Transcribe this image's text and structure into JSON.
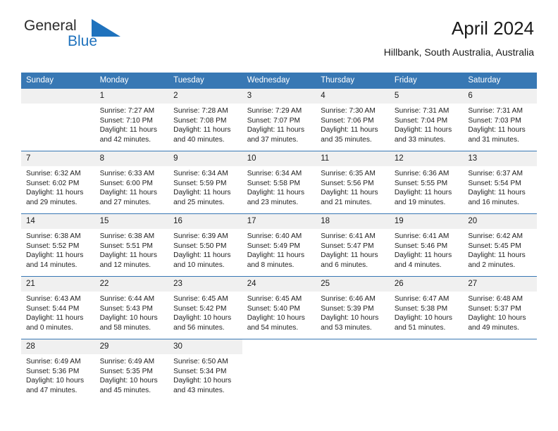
{
  "brand": {
    "name_top": "General",
    "name_bottom": "Blue",
    "triangle_color": "#1f72bd",
    "accent_color": "#1f72bd"
  },
  "header": {
    "title": "April 2024",
    "subtitle": "Hillbank, South Australia, Australia",
    "header_bg": "#3878b4",
    "header_text": "#ffffff",
    "daynum_bg": "#f0f0f0"
  },
  "weekdays": [
    "Sunday",
    "Monday",
    "Tuesday",
    "Wednesday",
    "Thursday",
    "Friday",
    "Saturday"
  ],
  "labels": {
    "sunrise": "Sunrise:",
    "sunset": "Sunset:",
    "daylight": "Daylight:"
  },
  "weeks": [
    [
      {
        "day": "",
        "sunrise": "",
        "sunset": "",
        "daylight1": "",
        "daylight2": "",
        "empty": true
      },
      {
        "day": "1",
        "sunrise": "Sunrise: 7:27 AM",
        "sunset": "Sunset: 7:10 PM",
        "daylight1": "Daylight: 11 hours",
        "daylight2": "and 42 minutes."
      },
      {
        "day": "2",
        "sunrise": "Sunrise: 7:28 AM",
        "sunset": "Sunset: 7:08 PM",
        "daylight1": "Daylight: 11 hours",
        "daylight2": "and 40 minutes."
      },
      {
        "day": "3",
        "sunrise": "Sunrise: 7:29 AM",
        "sunset": "Sunset: 7:07 PM",
        "daylight1": "Daylight: 11 hours",
        "daylight2": "and 37 minutes."
      },
      {
        "day": "4",
        "sunrise": "Sunrise: 7:30 AM",
        "sunset": "Sunset: 7:06 PM",
        "daylight1": "Daylight: 11 hours",
        "daylight2": "and 35 minutes."
      },
      {
        "day": "5",
        "sunrise": "Sunrise: 7:31 AM",
        "sunset": "Sunset: 7:04 PM",
        "daylight1": "Daylight: 11 hours",
        "daylight2": "and 33 minutes."
      },
      {
        "day": "6",
        "sunrise": "Sunrise: 7:31 AM",
        "sunset": "Sunset: 7:03 PM",
        "daylight1": "Daylight: 11 hours",
        "daylight2": "and 31 minutes."
      }
    ],
    [
      {
        "day": "7",
        "sunrise": "Sunrise: 6:32 AM",
        "sunset": "Sunset: 6:02 PM",
        "daylight1": "Daylight: 11 hours",
        "daylight2": "and 29 minutes."
      },
      {
        "day": "8",
        "sunrise": "Sunrise: 6:33 AM",
        "sunset": "Sunset: 6:00 PM",
        "daylight1": "Daylight: 11 hours",
        "daylight2": "and 27 minutes."
      },
      {
        "day": "9",
        "sunrise": "Sunrise: 6:34 AM",
        "sunset": "Sunset: 5:59 PM",
        "daylight1": "Daylight: 11 hours",
        "daylight2": "and 25 minutes."
      },
      {
        "day": "10",
        "sunrise": "Sunrise: 6:34 AM",
        "sunset": "Sunset: 5:58 PM",
        "daylight1": "Daylight: 11 hours",
        "daylight2": "and 23 minutes."
      },
      {
        "day": "11",
        "sunrise": "Sunrise: 6:35 AM",
        "sunset": "Sunset: 5:56 PM",
        "daylight1": "Daylight: 11 hours",
        "daylight2": "and 21 minutes."
      },
      {
        "day": "12",
        "sunrise": "Sunrise: 6:36 AM",
        "sunset": "Sunset: 5:55 PM",
        "daylight1": "Daylight: 11 hours",
        "daylight2": "and 19 minutes."
      },
      {
        "day": "13",
        "sunrise": "Sunrise: 6:37 AM",
        "sunset": "Sunset: 5:54 PM",
        "daylight1": "Daylight: 11 hours",
        "daylight2": "and 16 minutes."
      }
    ],
    [
      {
        "day": "14",
        "sunrise": "Sunrise: 6:38 AM",
        "sunset": "Sunset: 5:52 PM",
        "daylight1": "Daylight: 11 hours",
        "daylight2": "and 14 minutes."
      },
      {
        "day": "15",
        "sunrise": "Sunrise: 6:38 AM",
        "sunset": "Sunset: 5:51 PM",
        "daylight1": "Daylight: 11 hours",
        "daylight2": "and 12 minutes."
      },
      {
        "day": "16",
        "sunrise": "Sunrise: 6:39 AM",
        "sunset": "Sunset: 5:50 PM",
        "daylight1": "Daylight: 11 hours",
        "daylight2": "and 10 minutes."
      },
      {
        "day": "17",
        "sunrise": "Sunrise: 6:40 AM",
        "sunset": "Sunset: 5:49 PM",
        "daylight1": "Daylight: 11 hours",
        "daylight2": "and 8 minutes."
      },
      {
        "day": "18",
        "sunrise": "Sunrise: 6:41 AM",
        "sunset": "Sunset: 5:47 PM",
        "daylight1": "Daylight: 11 hours",
        "daylight2": "and 6 minutes."
      },
      {
        "day": "19",
        "sunrise": "Sunrise: 6:41 AM",
        "sunset": "Sunset: 5:46 PM",
        "daylight1": "Daylight: 11 hours",
        "daylight2": "and 4 minutes."
      },
      {
        "day": "20",
        "sunrise": "Sunrise: 6:42 AM",
        "sunset": "Sunset: 5:45 PM",
        "daylight1": "Daylight: 11 hours",
        "daylight2": "and 2 minutes."
      }
    ],
    [
      {
        "day": "21",
        "sunrise": "Sunrise: 6:43 AM",
        "sunset": "Sunset: 5:44 PM",
        "daylight1": "Daylight: 11 hours",
        "daylight2": "and 0 minutes."
      },
      {
        "day": "22",
        "sunrise": "Sunrise: 6:44 AM",
        "sunset": "Sunset: 5:43 PM",
        "daylight1": "Daylight: 10 hours",
        "daylight2": "and 58 minutes."
      },
      {
        "day": "23",
        "sunrise": "Sunrise: 6:45 AM",
        "sunset": "Sunset: 5:42 PM",
        "daylight1": "Daylight: 10 hours",
        "daylight2": "and 56 minutes."
      },
      {
        "day": "24",
        "sunrise": "Sunrise: 6:45 AM",
        "sunset": "Sunset: 5:40 PM",
        "daylight1": "Daylight: 10 hours",
        "daylight2": "and 54 minutes."
      },
      {
        "day": "25",
        "sunrise": "Sunrise: 6:46 AM",
        "sunset": "Sunset: 5:39 PM",
        "daylight1": "Daylight: 10 hours",
        "daylight2": "and 53 minutes."
      },
      {
        "day": "26",
        "sunrise": "Sunrise: 6:47 AM",
        "sunset": "Sunset: 5:38 PM",
        "daylight1": "Daylight: 10 hours",
        "daylight2": "and 51 minutes."
      },
      {
        "day": "27",
        "sunrise": "Sunrise: 6:48 AM",
        "sunset": "Sunset: 5:37 PM",
        "daylight1": "Daylight: 10 hours",
        "daylight2": "and 49 minutes."
      }
    ],
    [
      {
        "day": "28",
        "sunrise": "Sunrise: 6:49 AM",
        "sunset": "Sunset: 5:36 PM",
        "daylight1": "Daylight: 10 hours",
        "daylight2": "and 47 minutes."
      },
      {
        "day": "29",
        "sunrise": "Sunrise: 6:49 AM",
        "sunset": "Sunset: 5:35 PM",
        "daylight1": "Daylight: 10 hours",
        "daylight2": "and 45 minutes."
      },
      {
        "day": "30",
        "sunrise": "Sunrise: 6:50 AM",
        "sunset": "Sunset: 5:34 PM",
        "daylight1": "Daylight: 10 hours",
        "daylight2": "and 43 minutes."
      },
      {
        "day": "",
        "sunrise": "",
        "sunset": "",
        "daylight1": "",
        "daylight2": "",
        "blank": true
      },
      {
        "day": "",
        "sunrise": "",
        "sunset": "",
        "daylight1": "",
        "daylight2": "",
        "blank": true
      },
      {
        "day": "",
        "sunrise": "",
        "sunset": "",
        "daylight1": "",
        "daylight2": "",
        "blank": true
      },
      {
        "day": "",
        "sunrise": "",
        "sunset": "",
        "daylight1": "",
        "daylight2": "",
        "blank": true
      }
    ]
  ]
}
